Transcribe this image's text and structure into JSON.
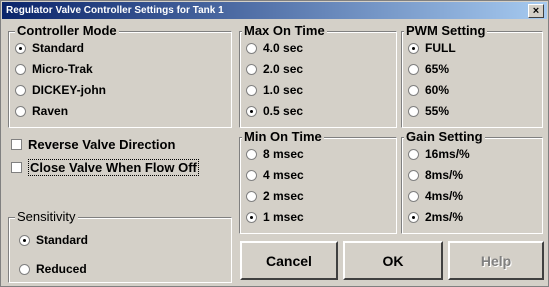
{
  "window": {
    "title": "Regulator Valve Controller Settings for Tank 1",
    "close_label": "×"
  },
  "controller_mode": {
    "label": "Controller Mode",
    "options": [
      {
        "label": "Standard",
        "selected": true
      },
      {
        "label": "Micro-Trak",
        "selected": false
      },
      {
        "label": "DICKEY-john",
        "selected": false
      },
      {
        "label": "Raven",
        "selected": false
      }
    ]
  },
  "max_on_time": {
    "label": "Max On Time",
    "options": [
      {
        "label": "4.0 sec",
        "selected": false
      },
      {
        "label": "2.0 sec",
        "selected": false
      },
      {
        "label": "1.0 sec",
        "selected": false
      },
      {
        "label": "0.5 sec",
        "selected": true
      }
    ]
  },
  "pwm_setting": {
    "label": "PWM Setting",
    "options": [
      {
        "label": "FULL",
        "selected": true
      },
      {
        "label": "65%",
        "selected": false
      },
      {
        "label": "60%",
        "selected": false
      },
      {
        "label": "55%",
        "selected": false
      }
    ]
  },
  "checkboxes": {
    "reverse_valve": {
      "label": "Reverse Valve Direction",
      "checked": false
    },
    "close_valve": {
      "label": "Close Valve When Flow Off",
      "checked": false
    }
  },
  "min_on_time": {
    "label": "Min On Time",
    "options": [
      {
        "label": "8 msec",
        "selected": false
      },
      {
        "label": "4 msec",
        "selected": false
      },
      {
        "label": "2 msec",
        "selected": false
      },
      {
        "label": "1 msec",
        "selected": true
      }
    ]
  },
  "gain_setting": {
    "label": "Gain Setting",
    "options": [
      {
        "label": "16ms/%",
        "selected": false
      },
      {
        "label": "8ms/%",
        "selected": false
      },
      {
        "label": "4ms/%",
        "selected": false
      },
      {
        "label": "2ms/%",
        "selected": true
      }
    ]
  },
  "sensitivity": {
    "label": "Sensitivity",
    "options": [
      {
        "label": "Standard",
        "selected": true
      },
      {
        "label": "Reduced",
        "selected": false
      }
    ]
  },
  "buttons": {
    "cancel": "Cancel",
    "ok": "OK",
    "help": "Help"
  }
}
